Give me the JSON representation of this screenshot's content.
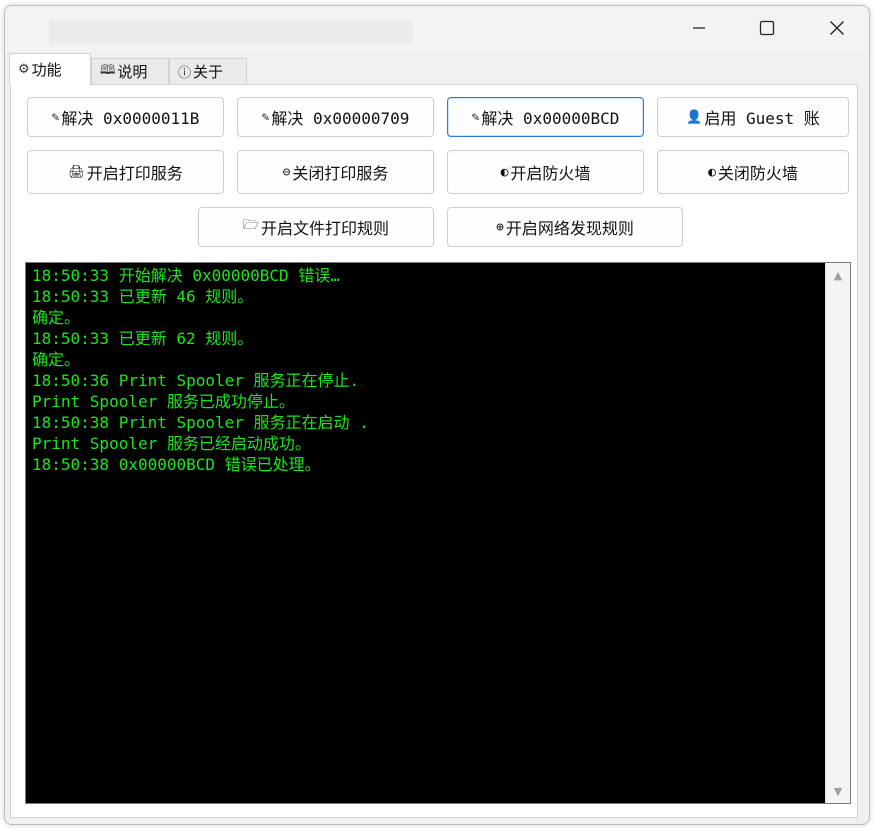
{
  "window": {
    "controls": {
      "minimize_icon": "minimize-icon",
      "maximize_icon": "maximize-icon",
      "close_icon": "close-icon"
    }
  },
  "tabs": [
    {
      "label": "功能",
      "icon": "gear-icon",
      "glyph": "⚙",
      "active": true
    },
    {
      "label": "说明",
      "icon": "book-icon",
      "glyph": "🕮",
      "active": false
    },
    {
      "label": "关于",
      "icon": "info-icon",
      "glyph": "ⓘ",
      "active": false
    }
  ],
  "buttons": {
    "fix_11b": {
      "label": "解决 0x0000011B",
      "icon": "wrench-icon",
      "glyph": "✎"
    },
    "fix_709": {
      "label": "解决 0x00000709",
      "icon": "wrench-icon",
      "glyph": "✎"
    },
    "fix_bcd": {
      "label": "解决 0x00000BCD",
      "icon": "wrench-icon",
      "glyph": "✎"
    },
    "guest": {
      "label": "启用 Guest 账",
      "icon": "user-icon",
      "glyph": "👤"
    },
    "print_on": {
      "label": "开启打印服务",
      "icon": "printer-icon",
      "glyph": "🖨"
    },
    "print_off": {
      "label": "关闭打印服务",
      "icon": "stop-icon",
      "glyph": "⊖"
    },
    "fw_on": {
      "label": "开启防火墙",
      "icon": "shield-icon",
      "glyph": "◐"
    },
    "fw_off": {
      "label": "关闭防火墙",
      "icon": "shield-icon",
      "glyph": "◐"
    },
    "file_rule": {
      "label": "开启文件打印规则",
      "icon": "folder-icon",
      "glyph": "🗁"
    },
    "net_rule": {
      "label": "开启网络发现规则",
      "icon": "globe-icon",
      "glyph": "⊕"
    }
  },
  "console": {
    "text_color": "#19e619",
    "background": "#000000",
    "lines": [
      "18:50:33 开始解决 0x00000BCD 错误…",
      "18:50:33 已更新 46 规则。",
      "确定。",
      "18:50:33 已更新 62 规则。",
      "确定。",
      "18:50:36 Print Spooler 服务正在停止.",
      "Print Spooler 服务已成功停止。",
      "18:50:38 Print Spooler 服务正在启动 .",
      "Print Spooler 服务已经启动成功。",
      "18:50:38 0x00000BCD 错误已处理。"
    ]
  }
}
